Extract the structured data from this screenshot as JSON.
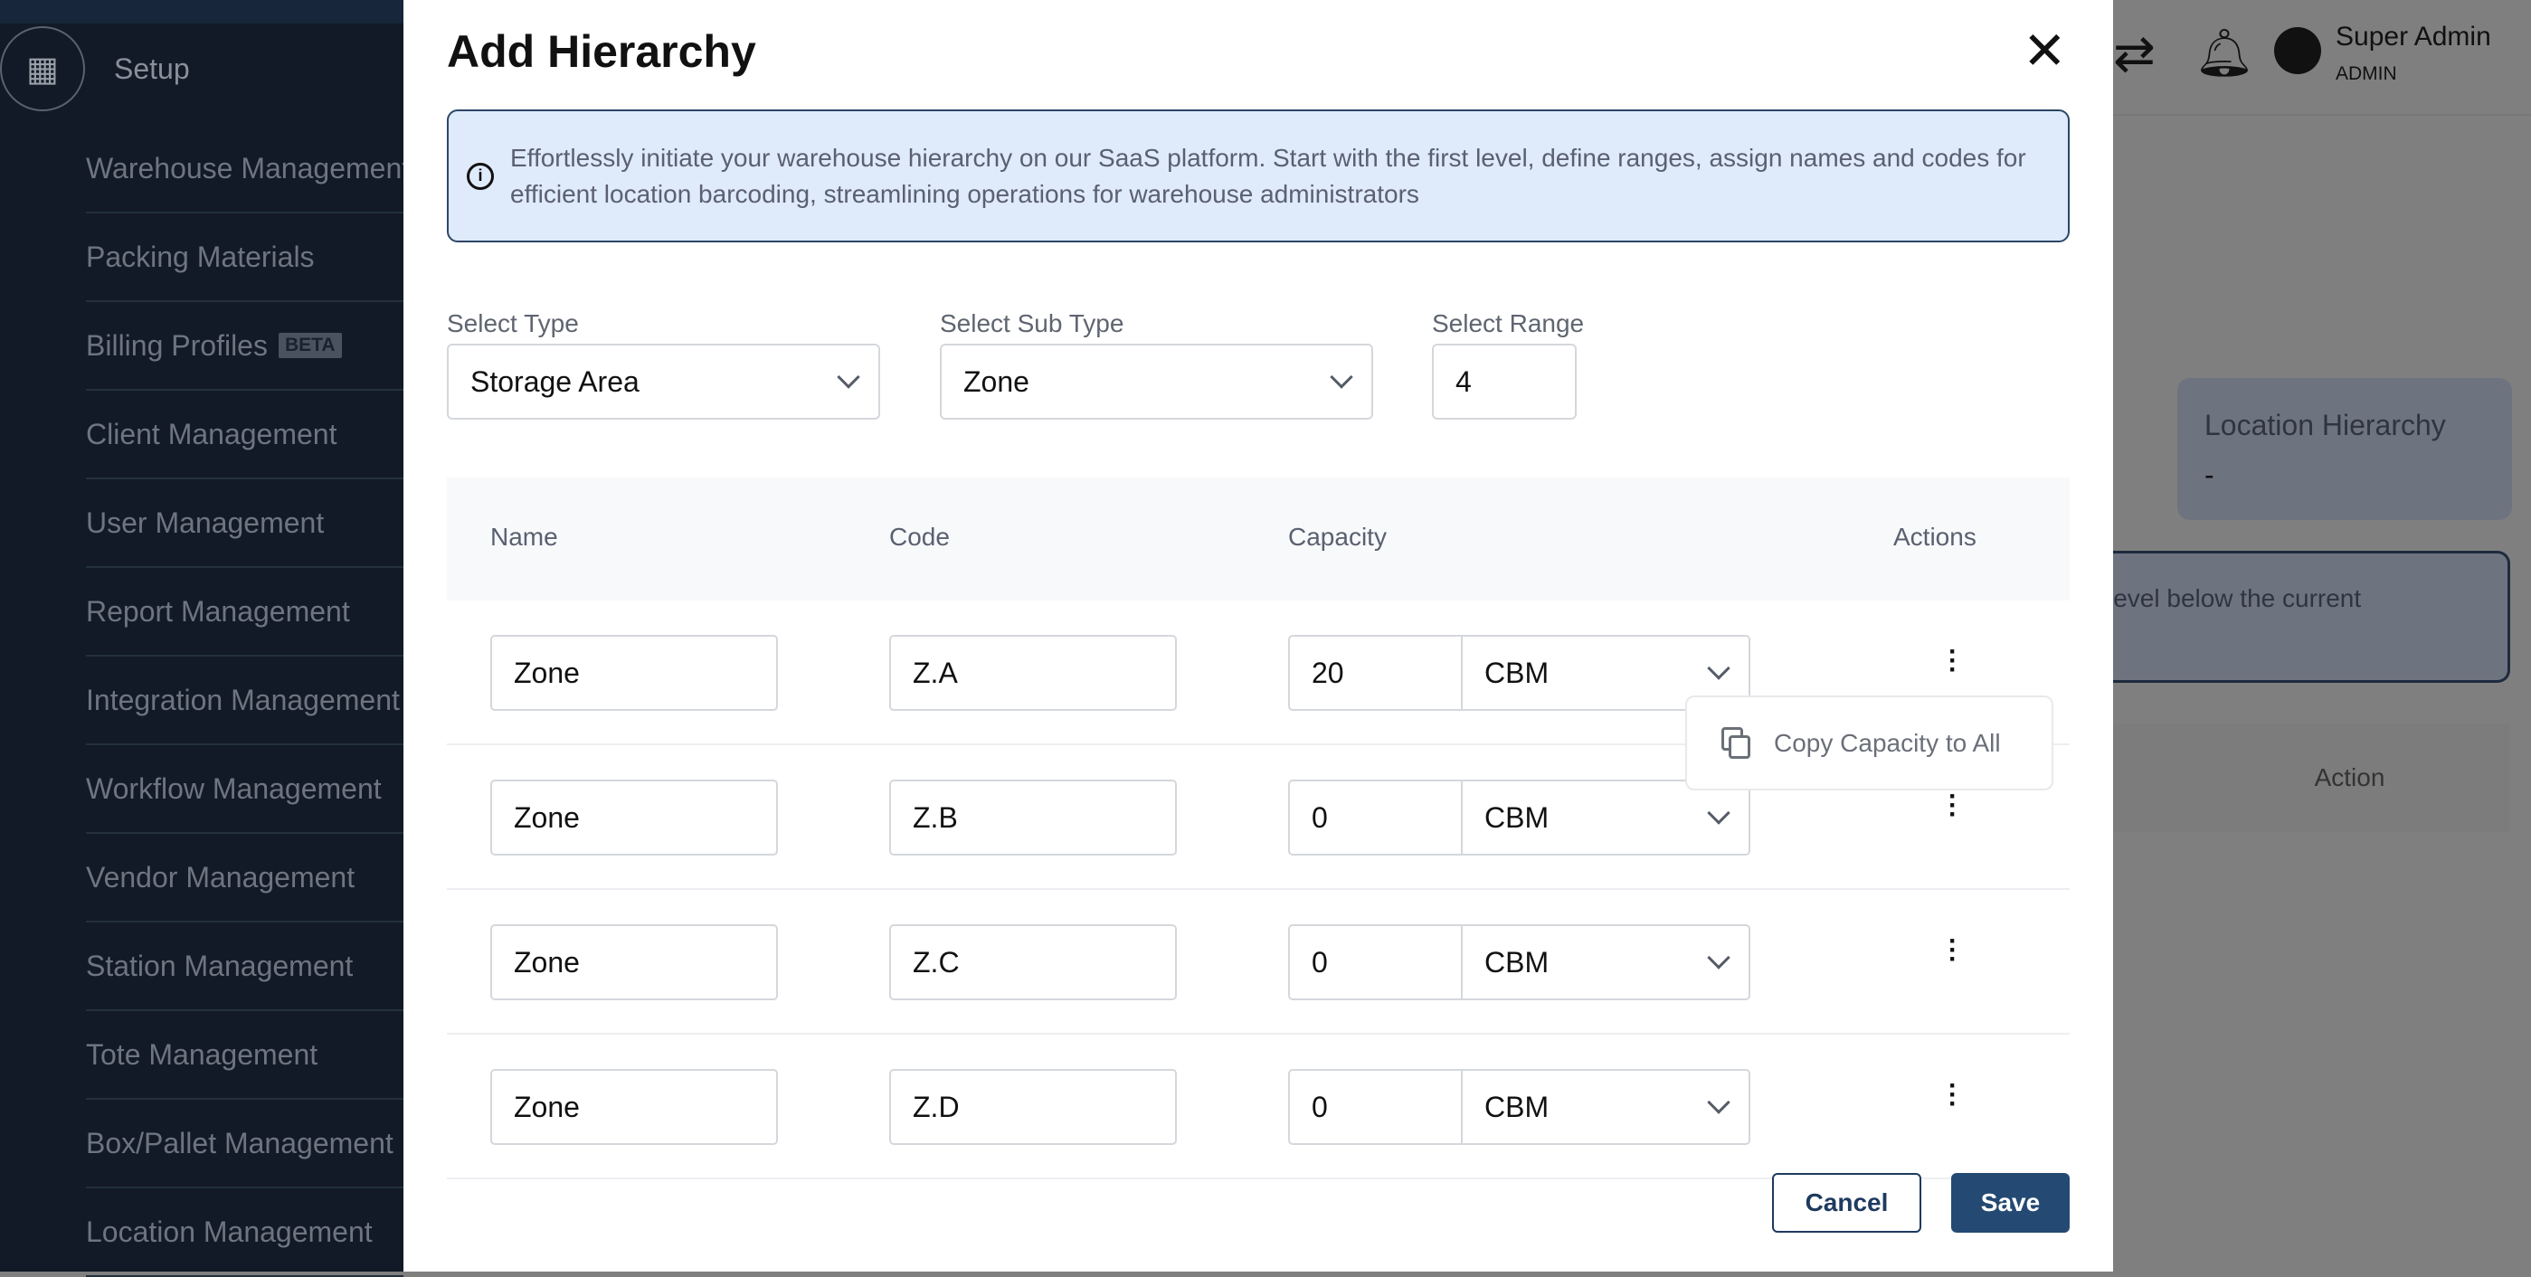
{
  "sidebar": {
    "section": "Setup",
    "items": [
      {
        "label": "Warehouse Management"
      },
      {
        "label": "Packing Materials"
      },
      {
        "label": "Billing Profiles",
        "badge": "BETA"
      },
      {
        "label": "Client Management"
      },
      {
        "label": "User Management"
      },
      {
        "label": "Report Management"
      },
      {
        "label": "Integration Management"
      },
      {
        "label": "Workflow Management"
      },
      {
        "label": "Vendor Management"
      },
      {
        "label": "Station Management"
      },
      {
        "label": "Tote Management"
      },
      {
        "label": "Box/Pallet Management"
      },
      {
        "label": "Location Management"
      }
    ]
  },
  "header": {
    "user_name": "Super Admin",
    "user_role": "ADMIN"
  },
  "background": {
    "card_title": "Location Hierarchy",
    "card_value": "-",
    "info_text": "level below the current",
    "action_header": "Action"
  },
  "modal": {
    "title": "Add Hierarchy",
    "info": "Effortlessly initiate your warehouse hierarchy on our SaaS platform. Start with the first level, define ranges, assign names and codes for efficient location barcoding, streamlining operations for warehouse administrators",
    "select_type": {
      "label": "Select Type",
      "value": "Storage Area"
    },
    "select_sub_type": {
      "label": "Select Sub Type",
      "value": "Zone"
    },
    "select_range": {
      "label": "Select Range",
      "value": "4"
    },
    "columns": [
      "Name",
      "Code",
      "Capacity",
      "Actions"
    ],
    "rows": [
      {
        "name": "Zone",
        "code": "Z.A",
        "capacity": "20",
        "unit": "CBM"
      },
      {
        "name": "Zone",
        "code": "Z.B",
        "capacity": "0",
        "unit": "CBM"
      },
      {
        "name": "Zone",
        "code": "Z.C",
        "capacity": "0",
        "unit": "CBM"
      },
      {
        "name": "Zone",
        "code": "Z.D",
        "capacity": "0",
        "unit": "CBM"
      }
    ],
    "popup_item": "Copy Capacity to All",
    "cancel": "Cancel",
    "save": "Save"
  }
}
